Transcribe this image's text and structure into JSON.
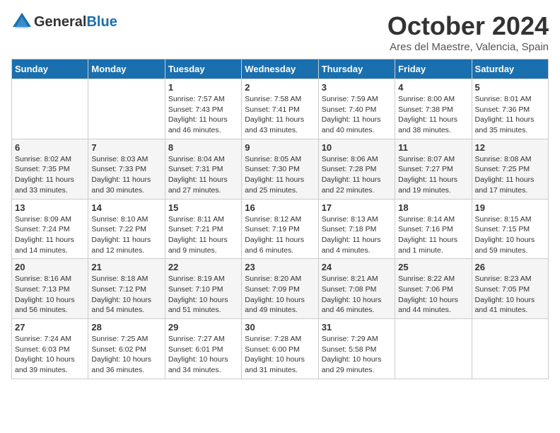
{
  "header": {
    "logo_general": "General",
    "logo_blue": "Blue",
    "month": "October 2024",
    "location": "Ares del Maestre, Valencia, Spain"
  },
  "weekdays": [
    "Sunday",
    "Monday",
    "Tuesday",
    "Wednesday",
    "Thursday",
    "Friday",
    "Saturday"
  ],
  "weeks": [
    [
      {
        "day": "",
        "info": ""
      },
      {
        "day": "",
        "info": ""
      },
      {
        "day": "1",
        "info": "Sunrise: 7:57 AM\nSunset: 7:43 PM\nDaylight: 11 hours and 46 minutes."
      },
      {
        "day": "2",
        "info": "Sunrise: 7:58 AM\nSunset: 7:41 PM\nDaylight: 11 hours and 43 minutes."
      },
      {
        "day": "3",
        "info": "Sunrise: 7:59 AM\nSunset: 7:40 PM\nDaylight: 11 hours and 40 minutes."
      },
      {
        "day": "4",
        "info": "Sunrise: 8:00 AM\nSunset: 7:38 PM\nDaylight: 11 hours and 38 minutes."
      },
      {
        "day": "5",
        "info": "Sunrise: 8:01 AM\nSunset: 7:36 PM\nDaylight: 11 hours and 35 minutes."
      }
    ],
    [
      {
        "day": "6",
        "info": "Sunrise: 8:02 AM\nSunset: 7:35 PM\nDaylight: 11 hours and 33 minutes."
      },
      {
        "day": "7",
        "info": "Sunrise: 8:03 AM\nSunset: 7:33 PM\nDaylight: 11 hours and 30 minutes."
      },
      {
        "day": "8",
        "info": "Sunrise: 8:04 AM\nSunset: 7:31 PM\nDaylight: 11 hours and 27 minutes."
      },
      {
        "day": "9",
        "info": "Sunrise: 8:05 AM\nSunset: 7:30 PM\nDaylight: 11 hours and 25 minutes."
      },
      {
        "day": "10",
        "info": "Sunrise: 8:06 AM\nSunset: 7:28 PM\nDaylight: 11 hours and 22 minutes."
      },
      {
        "day": "11",
        "info": "Sunrise: 8:07 AM\nSunset: 7:27 PM\nDaylight: 11 hours and 19 minutes."
      },
      {
        "day": "12",
        "info": "Sunrise: 8:08 AM\nSunset: 7:25 PM\nDaylight: 11 hours and 17 minutes."
      }
    ],
    [
      {
        "day": "13",
        "info": "Sunrise: 8:09 AM\nSunset: 7:24 PM\nDaylight: 11 hours and 14 minutes."
      },
      {
        "day": "14",
        "info": "Sunrise: 8:10 AM\nSunset: 7:22 PM\nDaylight: 11 hours and 12 minutes."
      },
      {
        "day": "15",
        "info": "Sunrise: 8:11 AM\nSunset: 7:21 PM\nDaylight: 11 hours and 9 minutes."
      },
      {
        "day": "16",
        "info": "Sunrise: 8:12 AM\nSunset: 7:19 PM\nDaylight: 11 hours and 6 minutes."
      },
      {
        "day": "17",
        "info": "Sunrise: 8:13 AM\nSunset: 7:18 PM\nDaylight: 11 hours and 4 minutes."
      },
      {
        "day": "18",
        "info": "Sunrise: 8:14 AM\nSunset: 7:16 PM\nDaylight: 11 hours and 1 minute."
      },
      {
        "day": "19",
        "info": "Sunrise: 8:15 AM\nSunset: 7:15 PM\nDaylight: 10 hours and 59 minutes."
      }
    ],
    [
      {
        "day": "20",
        "info": "Sunrise: 8:16 AM\nSunset: 7:13 PM\nDaylight: 10 hours and 56 minutes."
      },
      {
        "day": "21",
        "info": "Sunrise: 8:18 AM\nSunset: 7:12 PM\nDaylight: 10 hours and 54 minutes."
      },
      {
        "day": "22",
        "info": "Sunrise: 8:19 AM\nSunset: 7:10 PM\nDaylight: 10 hours and 51 minutes."
      },
      {
        "day": "23",
        "info": "Sunrise: 8:20 AM\nSunset: 7:09 PM\nDaylight: 10 hours and 49 minutes."
      },
      {
        "day": "24",
        "info": "Sunrise: 8:21 AM\nSunset: 7:08 PM\nDaylight: 10 hours and 46 minutes."
      },
      {
        "day": "25",
        "info": "Sunrise: 8:22 AM\nSunset: 7:06 PM\nDaylight: 10 hours and 44 minutes."
      },
      {
        "day": "26",
        "info": "Sunrise: 8:23 AM\nSunset: 7:05 PM\nDaylight: 10 hours and 41 minutes."
      }
    ],
    [
      {
        "day": "27",
        "info": "Sunrise: 7:24 AM\nSunset: 6:03 PM\nDaylight: 10 hours and 39 minutes."
      },
      {
        "day": "28",
        "info": "Sunrise: 7:25 AM\nSunset: 6:02 PM\nDaylight: 10 hours and 36 minutes."
      },
      {
        "day": "29",
        "info": "Sunrise: 7:27 AM\nSunset: 6:01 PM\nDaylight: 10 hours and 34 minutes."
      },
      {
        "day": "30",
        "info": "Sunrise: 7:28 AM\nSunset: 6:00 PM\nDaylight: 10 hours and 31 minutes."
      },
      {
        "day": "31",
        "info": "Sunrise: 7:29 AM\nSunset: 5:58 PM\nDaylight: 10 hours and 29 minutes."
      },
      {
        "day": "",
        "info": ""
      },
      {
        "day": "",
        "info": ""
      }
    ]
  ]
}
